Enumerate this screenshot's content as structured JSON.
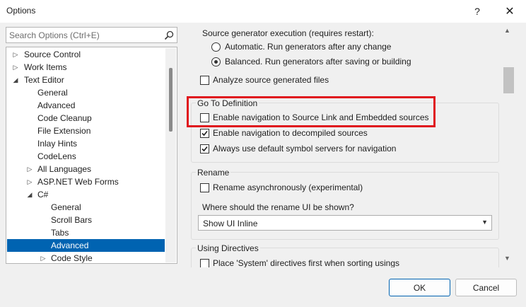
{
  "window": {
    "title": "Options",
    "help_label": "?",
    "close_label": "✕"
  },
  "search": {
    "placeholder": "Search Options (Ctrl+E)",
    "icon": "search-icon"
  },
  "tree": {
    "items": [
      {
        "label": "Source Control",
        "arrow": "▷",
        "selected": false
      },
      {
        "label": "Work Items",
        "arrow": "▷",
        "selected": false
      },
      {
        "label": "Text Editor",
        "arrow": "◢",
        "selected": false
      },
      {
        "label": "General",
        "arrow": "",
        "selected": false
      },
      {
        "label": "Advanced",
        "arrow": "",
        "selected": false
      },
      {
        "label": "Code Cleanup",
        "arrow": "",
        "selected": false
      },
      {
        "label": "File Extension",
        "arrow": "",
        "selected": false
      },
      {
        "label": "Inlay Hints",
        "arrow": "",
        "selected": false
      },
      {
        "label": "CodeLens",
        "arrow": "",
        "selected": false
      },
      {
        "label": "All Languages",
        "arrow": "▷",
        "selected": false
      },
      {
        "label": "ASP.NET Web Forms",
        "arrow": "▷",
        "selected": false
      },
      {
        "label": "C#",
        "arrow": "◢",
        "selected": false
      },
      {
        "label": "General",
        "arrow": "",
        "selected": false
      },
      {
        "label": "Scroll Bars",
        "arrow": "",
        "selected": false
      },
      {
        "label": "Tabs",
        "arrow": "",
        "selected": false
      },
      {
        "label": "Advanced",
        "arrow": "",
        "selected": true
      },
      {
        "label": "Code Style",
        "arrow": "▷",
        "selected": false
      }
    ]
  },
  "settings": {
    "source_generator": {
      "label": "Source generator execution (requires restart):",
      "options": [
        {
          "label": "Automatic. Run generators after any change",
          "checked": false
        },
        {
          "label": "Balanced. Run generators after saving or building",
          "checked": true
        }
      ]
    },
    "analyze_generated": {
      "label": "Analyze source generated files",
      "checked": false
    },
    "go_to_definition": {
      "header": "Go To Definition",
      "options": [
        {
          "label": "Enable navigation to Source Link and Embedded sources",
          "checked": false
        },
        {
          "label": "Enable navigation to decompiled sources",
          "checked": true
        },
        {
          "label": "Always use default symbol servers for navigation",
          "checked": true
        }
      ]
    },
    "rename": {
      "header": "Rename",
      "async_label": "Rename asynchronously (experimental)",
      "async_checked": false,
      "ui_question": "Where should the rename UI be shown?",
      "ui_value": "Show UI Inline"
    },
    "using_directives": {
      "header": "Using Directives",
      "first_option": "Place 'System' directives first when sorting usings"
    }
  },
  "buttons": {
    "ok": "OK",
    "cancel": "Cancel"
  },
  "colors": {
    "accent": "#0063b1",
    "highlight_box": "#e0161e"
  }
}
